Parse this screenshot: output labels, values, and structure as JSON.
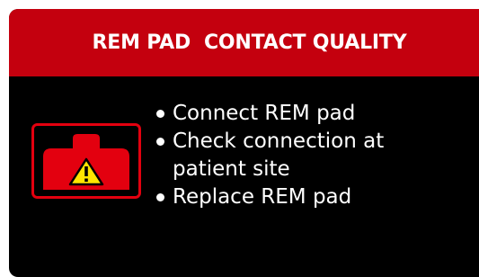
{
  "alert": {
    "title": "REM PAD  CONTACT QUALITY",
    "icon": "rem-pad-warning-icon",
    "instructions": [
      "Connect REM pad",
      "Check connection at patient site",
      "Replace REM pad"
    ]
  },
  "colors": {
    "header_background": "#c4000e",
    "body_background": "#000000",
    "text": "#ffffff",
    "icon_red": "#e3000f",
    "icon_warning_yellow": "#ffe500"
  }
}
